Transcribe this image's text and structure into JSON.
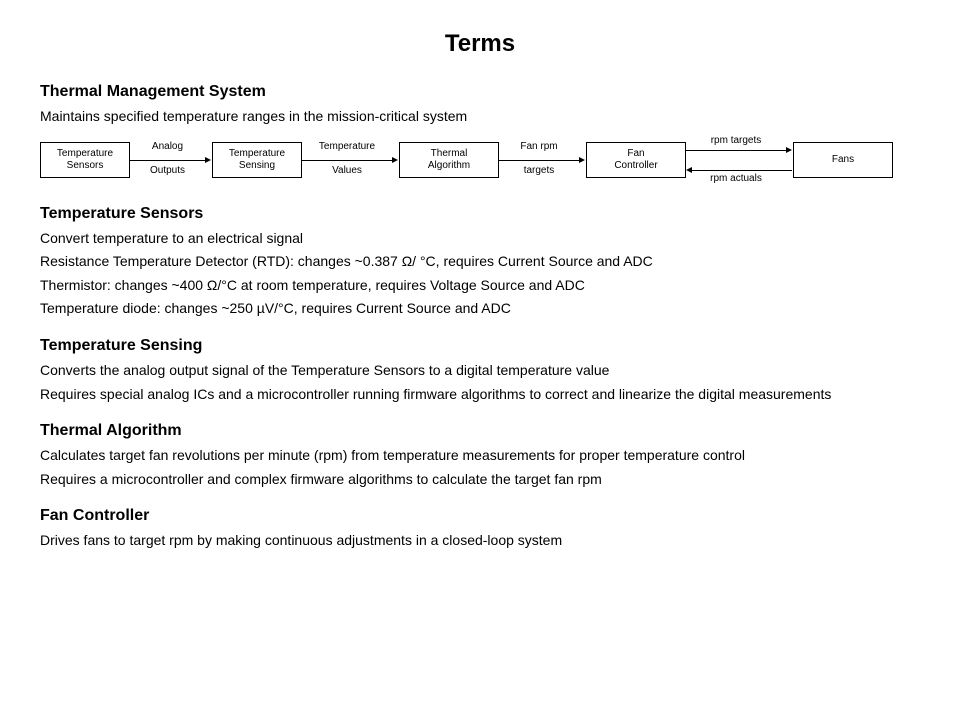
{
  "title": "Terms",
  "sections": {
    "tms": {
      "heading": "Thermal Management System",
      "desc": "Maintains specified temperature ranges in the mission-critical system"
    },
    "tempSensors": {
      "heading": "Temperature Sensors",
      "line1": "Convert temperature to an electrical signal",
      "line2": "Resistance Temperature Detector (RTD): changes ~0.387 Ω/ °C, requires Current Source and ADC",
      "line3": "Thermistor: changes ~400 Ω/°C at room temperature, requires Voltage Source and ADC",
      "line4": "Temperature diode: changes ~250 µV/°C, requires Current Source and ADC"
    },
    "tempSensing": {
      "heading": "Temperature Sensing",
      "line1": "Converts the analog output signal of the Temperature Sensors to a digital temperature value",
      "line2": "Requires special analog ICs and a microcontroller running firmware algorithms to correct and linearize the digital measurements"
    },
    "thermalAlg": {
      "heading": "Thermal Algorithm",
      "line1": "Calculates target fan revolutions per minute (rpm) from temperature measurements for proper temperature control",
      "line2": "Requires a microcontroller and complex firmware algorithms to calculate the target fan rpm"
    },
    "fanCtrl": {
      "heading": "Fan Controller",
      "line1": "Drives fans to target rpm by making continuous adjustments in a closed-loop system"
    }
  },
  "diagram": {
    "box1a": "Temperature",
    "box1b": "Sensors",
    "label1a": "Analog",
    "label1b": "Outputs",
    "box2a": "Temperature",
    "box2b": "Sensing",
    "label2a": "Temperature",
    "label2b": "Values",
    "box3a": "Thermal",
    "box3b": "Algorithm",
    "label3a": "Fan rpm",
    "label3b": "targets",
    "box4a": "Fan",
    "box4b": "Controller",
    "label4a": "rpm targets",
    "label4b": "rpm actuals",
    "box5": "Fans"
  }
}
